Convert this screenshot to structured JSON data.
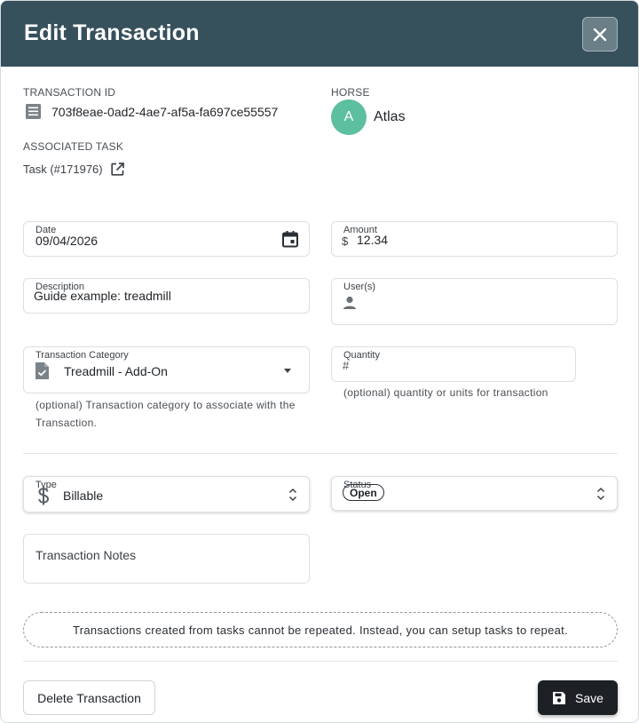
{
  "header": {
    "title": "Edit Transaction",
    "close_icon": "close-icon"
  },
  "transaction": {
    "id_label": "TRANSACTION ID",
    "id_value": "703f8eae-0ad2-4ae7-af5a-fa697ce55557",
    "id_icon": "receipt-icon"
  },
  "horse": {
    "label": "HORSE",
    "avatar_letter": "A",
    "name": "Atlas",
    "avatar_color": "#5cbf9f"
  },
  "task": {
    "label": "ASSOCIATED TASK",
    "value": "Task (#171976)",
    "icon": "external-link-icon"
  },
  "date": {
    "label": "Date",
    "value": "09/04/2026",
    "icon": "calendar-icon"
  },
  "amount": {
    "label": "Amount",
    "currency_symbol": "$",
    "value": "12.34"
  },
  "description": {
    "label": "Description",
    "value": "Guide example: treadmill"
  },
  "users": {
    "label": "User(s)",
    "value": "",
    "icon": "person-icon"
  },
  "category": {
    "label": "Transaction Category",
    "value": "Treadmill - Add-On",
    "icon": "document-check-icon",
    "help": "(optional) Transaction category to associate with the Transaction."
  },
  "quantity": {
    "label": "Quantity",
    "placeholder": "#",
    "help": "(optional) quantity or units for transaction"
  },
  "type": {
    "label": "Type",
    "value": "Billable",
    "icon": "dollar-icon"
  },
  "status": {
    "label": "Status",
    "value": "Open"
  },
  "notes": {
    "placeholder": "Transaction Notes"
  },
  "notice": "Transactions created from tasks cannot be repeated. Instead, you can setup tasks to repeat.",
  "footer": {
    "delete_label": "Delete Transaction",
    "save_label": "Save"
  },
  "colors": {
    "header_bg": "#36505c",
    "save_bg": "#1d2126",
    "avatar": "#5cbf9f"
  }
}
